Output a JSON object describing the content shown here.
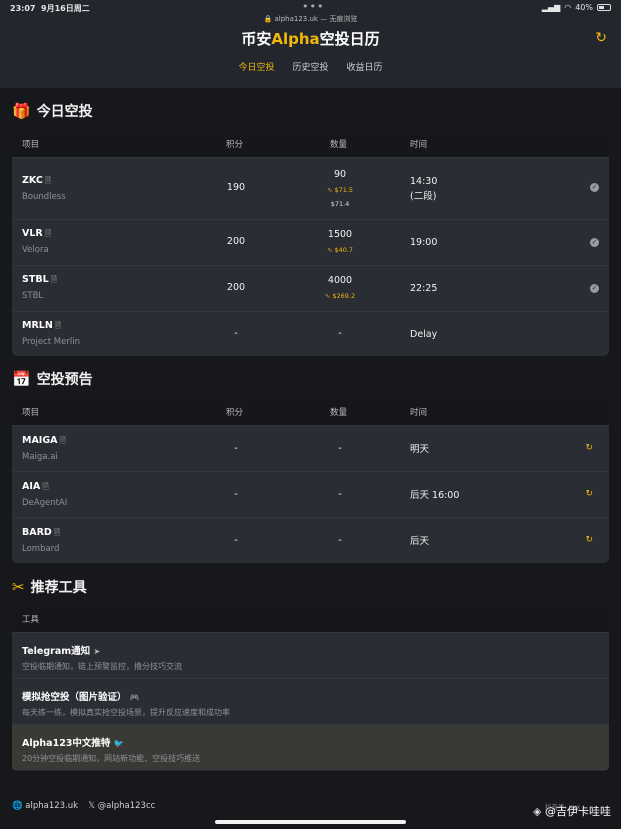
{
  "statusbar": {
    "time": "23:07",
    "date": "9月16日周二",
    "dots": "•••",
    "url": "alpha123.uk — 无痕浏览",
    "battery": "40%"
  },
  "header": {
    "title_prefix": "币安",
    "title_alpha": "Alpha",
    "title_suffix": "空投日历",
    "refresh_icon": "refresh-icon",
    "tabs": [
      {
        "label": "今日空投",
        "active": true
      },
      {
        "label": "历史空投",
        "active": false
      },
      {
        "label": "收益日历",
        "active": false
      }
    ]
  },
  "today": {
    "title": "今日空投",
    "icon": "gift-icon",
    "columns": [
      "项目",
      "积分",
      "数量",
      "时间"
    ],
    "rows": [
      {
        "symbol": "ZKC",
        "name": "Boundless",
        "points": "190",
        "qty": "90",
        "qty_price": "$71.5",
        "qty_price2": "$71.4",
        "time": "14:30",
        "time2": "(二段)",
        "status": "check"
      },
      {
        "symbol": "VLR",
        "name": "Velora",
        "points": "200",
        "qty": "1500",
        "qty_price": "$40.7",
        "time": "19:00",
        "status": "check"
      },
      {
        "symbol": "STBL",
        "name": "STBL",
        "points": "200",
        "qty": "4000",
        "qty_price": "$269.2",
        "time": "22:25",
        "status": "check"
      },
      {
        "symbol": "MRLN",
        "name": "Project Merlin",
        "points": "-",
        "qty": "-",
        "time": "Delay",
        "status": "none"
      }
    ]
  },
  "preview": {
    "title": "空投预告",
    "icon": "calendar-icon",
    "columns": [
      "项目",
      "积分",
      "数量",
      "时间"
    ],
    "rows": [
      {
        "symbol": "MAIGA",
        "name": "Maiga.ai",
        "points": "-",
        "qty": "-",
        "time": "明天"
      },
      {
        "symbol": "AIA",
        "name": "DeAgentAI",
        "points": "-",
        "qty": "-",
        "time": "后天 16:00"
      },
      {
        "symbol": "BARD",
        "name": "Lombard",
        "points": "-",
        "qty": "-",
        "time": "后天"
      }
    ]
  },
  "tools": {
    "title": "推荐工具",
    "icon": "tools-icon",
    "column": "工具",
    "items": [
      {
        "name": "Telegram通知",
        "desc": "空投临期通知，链上预警监控，撸分技巧交流",
        "icon": "telegram-icon"
      },
      {
        "name": "模拟抢空投（图片验证）",
        "desc": "每天练一练，模拟真实抢空投场景，提升反应速度和成功率",
        "icon": "gamepad-icon"
      },
      {
        "name": "Alpha123中文推特",
        "desc": "20分钟空投临期通知，网站新功能、空投技巧推送",
        "icon": "twitter-icon"
      }
    ]
  },
  "footer": {
    "site": "alpha123.uk",
    "x_handle": "@alpha123cc",
    "watermark": "@吉伊卡哇哇",
    "watermark_small": "抖音号: xxx"
  },
  "colors": {
    "accent": "#f0b90b",
    "bg": "#17181c",
    "card": "#2a2d34"
  }
}
